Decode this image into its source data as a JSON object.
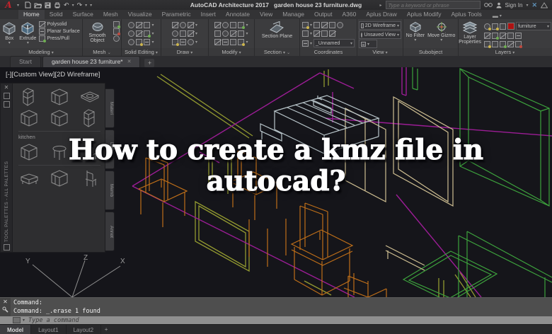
{
  "title_bar": {
    "app_title": "AutoCAD Architecture 2017",
    "doc_title": "garden house 23 furniture.dwg",
    "search_placeholder": "Type a keyword or phrase",
    "sign_in_label": "Sign In"
  },
  "ribbon": {
    "active_tab": "Home",
    "tabs": [
      "Home",
      "Solid",
      "Surface",
      "Mesh",
      "Visualize",
      "Parametric",
      "Insert",
      "Annotate",
      "View",
      "Manage",
      "Output",
      "A360",
      "Aplus Draw",
      "Aplus Modify",
      "Aplus Tools"
    ],
    "panels": {
      "modeling": {
        "label": "Modeling",
        "box": "Box",
        "extrude": "Extrude",
        "polysolid": "Polysolid",
        "planar_surface": "Planar Surface",
        "press_pull": "Press/Pull"
      },
      "mesh": {
        "label": "Mesh",
        "smooth_object": "Smooth Object"
      },
      "solid_editing": {
        "label": "Solid Editing"
      },
      "draw": {
        "label": "Draw"
      },
      "modify": {
        "label": "Modify"
      },
      "section": {
        "label": "Section",
        "section_plane": "Section Plane"
      },
      "coordinates": {
        "label": "Coordinates",
        "ucs_name": "_Unnamed"
      },
      "view": {
        "label": "View",
        "visual_style": "2D Wireframe",
        "saved_view": "Unsaved View"
      },
      "subobject": {
        "label": "Subobject",
        "no_filter": "No Filter",
        "move_gizmo": "Move Gizmo"
      },
      "layers": {
        "label": "Layers",
        "layer_properties": "Layer Properties",
        "current_layer": "furniture"
      }
    }
  },
  "file_tabs": {
    "start": "Start",
    "drawing": "garden house 23 furniture*",
    "new_tab": "+"
  },
  "canvas": {
    "viewport_label": "[-][Custom View][2D Wireframe]",
    "overlay": {
      "line1": "How to create a kmz file in",
      "line2": "autocad?"
    },
    "ucs": {
      "x": "X",
      "y": "Y",
      "z": "Z"
    }
  },
  "palette": {
    "title": "TOOL PALETTES - ALL PALETTES",
    "section_label": "kitchen",
    "side_tabs": [
      "Materi",
      "Details",
      "Memb",
      "Annot"
    ]
  },
  "command": {
    "line1": "Command:",
    "line2": "Command: _.erase 1 found",
    "input_placeholder": "Type a command"
  },
  "layout_tabs": {
    "model": "Model",
    "layout1": "Layout1",
    "layout2": "Layout2",
    "new_layout": "+"
  },
  "colors": {
    "logo_red": "#c4232c",
    "layer_swatch": "#ad1212",
    "wire_olive": "#939a30",
    "wire_magenta": "#9c1d96",
    "wire_orange": "#bf6f19",
    "wire_green": "#3da23d",
    "wire_tan": "#cfbf92",
    "wire_gray": "#b9c6cb"
  }
}
